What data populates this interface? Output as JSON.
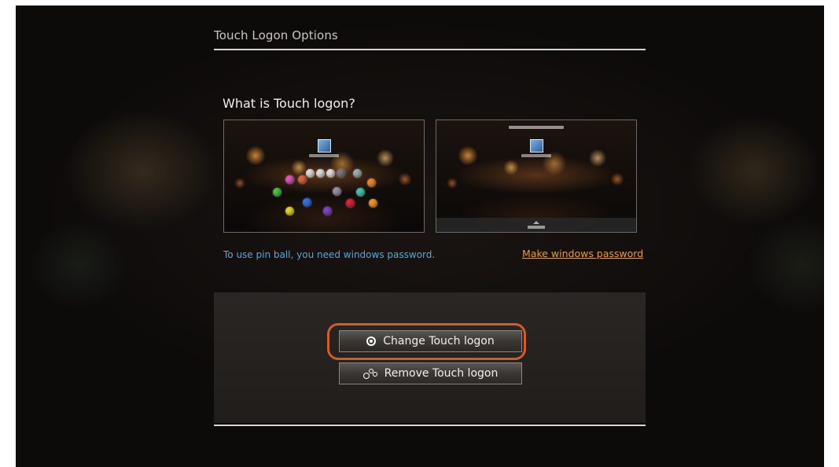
{
  "header": {
    "title": "Touch Logon Options"
  },
  "section": {
    "heading": "What is Touch logon?"
  },
  "previews": [
    {
      "icon": "pin-ball-logon-screenshot"
    },
    {
      "icon": "unlock-logon-screenshot"
    }
  ],
  "info": {
    "text": "To use pin ball, you need windows password.",
    "link_label": "Make windows password"
  },
  "actions": {
    "change_label": "Change Touch logon",
    "change_icon": "ring-icon",
    "remove_label": "Remove Touch logon",
    "remove_icon": "balls-icon"
  },
  "colors": {
    "info_text": "#4fa9dc",
    "link": "#e0a040",
    "highlight": "#d45a26",
    "background": "#0d0b0a"
  }
}
